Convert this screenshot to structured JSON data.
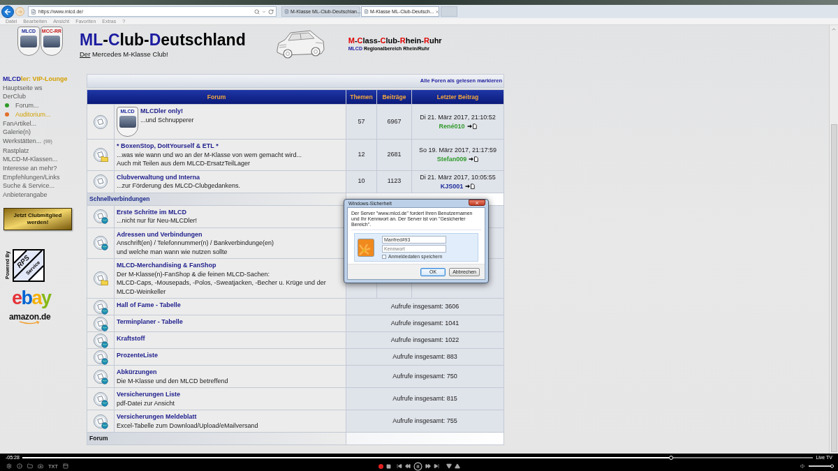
{
  "browser": {
    "url": "https://www.mlcd.de/",
    "tabs": [
      {
        "title": "M-Klasse ML-Club-Deutschlan...",
        "selected": false
      },
      {
        "title": "M-Klasse ML-Club-Deutsch...",
        "selected": true
      }
    ],
    "menu": [
      "Datei",
      "Bearbeiten",
      "Ansicht",
      "Favoriten",
      "Extras",
      "?"
    ]
  },
  "header": {
    "logos": [
      "MLCD",
      "MCC-RR"
    ],
    "title": [
      {
        "text": "ML",
        "accent": true
      },
      {
        "text": "-",
        "accent": false
      },
      {
        "text": "C",
        "accent": true
      },
      {
        "text": "lub-",
        "accent": false
      },
      {
        "text": "D",
        "accent": true
      },
      {
        "text": "eutschland",
        "accent": false
      }
    ],
    "subtitle": [
      {
        "text": "Der",
        "underline": true
      },
      {
        "text": " Mercedes M-Klasse Club!",
        "underline": false
      }
    ],
    "regional_title": [
      {
        "text": "M",
        "accent": true
      },
      {
        "text": "-",
        "accent": false
      },
      {
        "text": "C",
        "accent": true
      },
      {
        "text": "lass-",
        "accent": false
      },
      {
        "text": "C",
        "accent": true
      },
      {
        "text": "lub-",
        "accent": false
      },
      {
        "text": "R",
        "accent": true
      },
      {
        "text": "hein-",
        "accent": false
      },
      {
        "text": "R",
        "accent": true
      },
      {
        "text": "uhr",
        "accent": false
      }
    ],
    "regional_subtitle": [
      {
        "text": "MLCD",
        "accent": true
      },
      {
        "text": " Regionalbereich Rhein/Ruhr",
        "accent": false
      }
    ]
  },
  "sidebar": {
    "vip": [
      {
        "text": "MLCD",
        "accent": true
      },
      {
        "text": "ler: VIP-Lounge",
        "accent": false
      }
    ],
    "items": [
      {
        "label": "Hauptseite ws",
        "kind": "link",
        "highlighted": false
      },
      {
        "label": "DerClub",
        "kind": "link",
        "highlighted": false
      },
      {
        "label": "Forum...",
        "kind": "dot",
        "color": "#2f9a2a",
        "highlighted": false
      },
      {
        "label": "Auditorium...",
        "kind": "dot",
        "color": "#e0702c",
        "highlighted": true
      },
      {
        "label": "FanArtikel...",
        "kind": "link",
        "highlighted": false
      },
      {
        "label": "Galerie(n)",
        "kind": "link",
        "highlighted": false
      },
      {
        "label": "Werkstätten...",
        "kind": "link",
        "count": "(99)",
        "highlighted": false
      },
      {
        "label": "Rastplatz",
        "kind": "link",
        "highlighted": false
      },
      {
        "label": "MLCD-M-Klassen...",
        "kind": "link",
        "highlighted": false
      },
      {
        "label": "Interesse an mehr?",
        "kind": "link",
        "highlighted": false
      },
      {
        "label": "Empfehlungen/Links",
        "kind": "link",
        "highlighted": false
      },
      {
        "label": "Suche & Service...",
        "kind": "link",
        "highlighted": false
      },
      {
        "label": "Anbieterangabe",
        "kind": "link",
        "highlighted": false
      }
    ],
    "cta": "Jetzt Clubmitglied werden!",
    "powered_by": "Powered By",
    "rps_logo": {
      "mark": "RPS",
      "text": "Service"
    },
    "ebay_logo": "ebay",
    "amazon_logo": "amazon.de"
  },
  "table": {
    "mark_all": "Alle Foren als gelesen markieren",
    "columns": [
      "Forum",
      "Themen",
      "Beiträge",
      "Letzter Beitrag"
    ],
    "rows": [
      {
        "kind": "forum",
        "unread": false,
        "redirect": false,
        "logo": "MLCD",
        "name": "MLCDler only!",
        "description": [
          "...und Schnupperer"
        ],
        "topics": "57",
        "posts": "6967",
        "last_post": {
          "date": "Di 21. März 2017, 21:10:52",
          "user": "René010",
          "color": "#2f9a2a"
        }
      },
      {
        "kind": "forum",
        "unread": true,
        "redirect": false,
        "name": "* BoxenStop, DoItYourself & ETL *",
        "description": [
          "...was wie wann und wo an der M-Klasse von wem gemacht wird...",
          "Auch mit Teilen aus dem MLCD-ErsatzTeilLager"
        ],
        "topics": "12",
        "posts": "2681",
        "last_post": {
          "date": "So 19. März 2017, 21:17:59",
          "user": "Stefan009",
          "color": "#2f9a2a"
        }
      },
      {
        "kind": "forum",
        "unread": false,
        "redirect": false,
        "name": "Clubverwaltung und Interna",
        "description": [
          "...zur Förderung des MLCD-Clubgedankens."
        ],
        "topics": "10",
        "posts": "1123",
        "last_post": {
          "date": "Di 21. März 2017, 10:05:55",
          "user": "KJS001",
          "color": "#1c2a9c"
        }
      },
      {
        "kind": "section",
        "title": "Schnellverbindungen",
        "color": "#1c2a8c"
      },
      {
        "kind": "forum",
        "unread": false,
        "redirect": true,
        "name": "Erste Schritte im MLCD",
        "description": [
          "...nicht nur für Neu-MLCDler!"
        ]
      },
      {
        "kind": "forum",
        "unread": false,
        "redirect": true,
        "name": "Adressen und Verbindungen",
        "description": [
          "Anschrift(en) / Telefonnummer(n) / Bankverbindunge(en)",
          "und welche man wann wie nutzen sollte"
        ]
      },
      {
        "kind": "forum",
        "unread": true,
        "redirect": false,
        "name": "MLCD-Merchandising & FanShop",
        "description": [
          "Der M-Klasse(n)-FanShop & die feinen MLCD-Sachen:",
          "MLCD-Caps, -Mousepads, -Polos, -Sweatjacken, -Becher u. Krüge und der MLCD-Weinkeller"
        ]
      },
      {
        "kind": "link",
        "unread": false,
        "redirect": true,
        "name": "Hall of Fame - Tabelle",
        "views": "Aufrufe insgesamt: 3606"
      },
      {
        "kind": "link",
        "unread": false,
        "redirect": true,
        "name": "Terminplaner - Tabelle",
        "views": "Aufrufe insgesamt: 1041"
      },
      {
        "kind": "link",
        "unread": false,
        "redirect": true,
        "name": "Kraftstoff",
        "views": "Aufrufe insgesamt: 1022"
      },
      {
        "kind": "link",
        "unread": false,
        "redirect": true,
        "name": "ProzenteListe",
        "views": "Aufrufe insgesamt: 883"
      },
      {
        "kind": "link",
        "unread": false,
        "redirect": true,
        "name": "Abkürzungen",
        "description": [
          "Die M-Klasse und den MLCD betreffend"
        ],
        "views": "Aufrufe insgesamt: 750"
      },
      {
        "kind": "link",
        "unread": false,
        "redirect": true,
        "name": "Versicherungen Liste",
        "description": [
          "pdf-Datei zur Ansicht"
        ],
        "views": "Aufrufe insgesamt: 815"
      },
      {
        "kind": "link",
        "unread": false,
        "redirect": true,
        "name": "Versicherungen Meldeblatt",
        "description": [
          "Excel-Tabelle zum Download/Upload/eMailversand"
        ],
        "views": "Aufrufe insgesamt: 755"
      },
      {
        "kind": "section",
        "title": "Forum",
        "color": "#111111"
      }
    ]
  },
  "dialog": {
    "title": "Windows-Sicherheit",
    "message": "Der Server \"www.mlcd.de\" fordert Ihren Benutzernamen und Ihr Kennwort an. Der Server ist von \"Gesicherter Bereich\".",
    "username": "Manfred#93",
    "password_placeholder": "Kennwort",
    "remember": {
      "label": "Anmeldedaten speichern",
      "checked": false
    },
    "buttons": [
      {
        "label": "OK",
        "default": true
      },
      {
        "label": "Abbrechen",
        "default": false
      }
    ]
  },
  "player": {
    "time": "-05:28",
    "live_label": "Live TV",
    "progress": {
      "level": 0.82
    },
    "txt_label": "TXT",
    "volume": {
      "level": 1
    }
  }
}
